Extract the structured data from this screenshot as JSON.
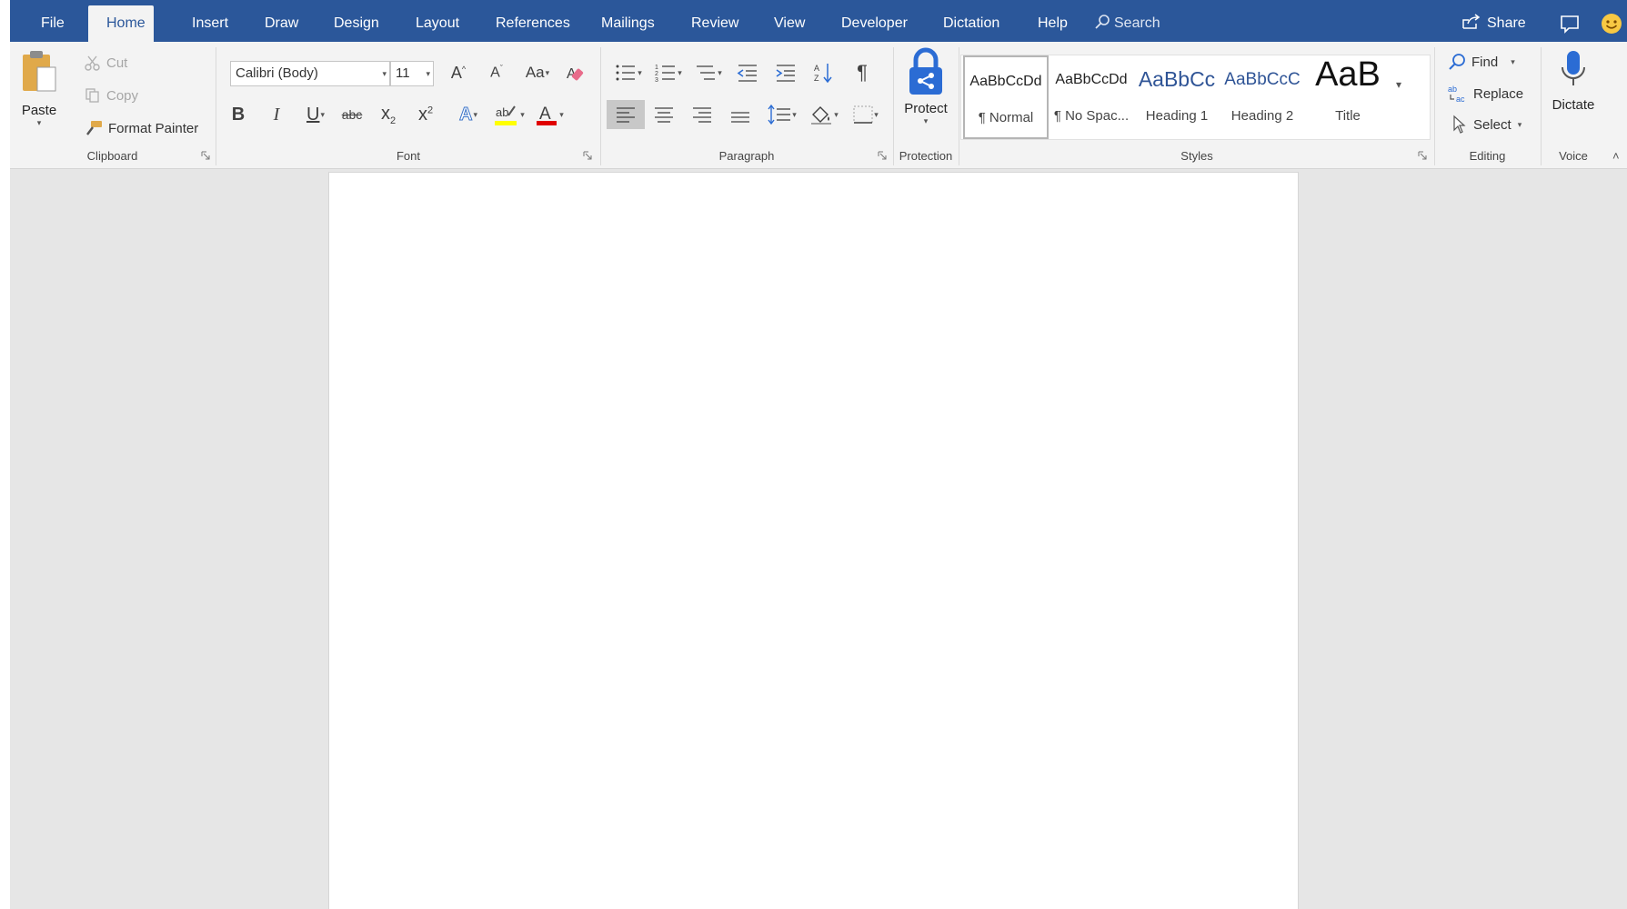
{
  "tabs": [
    {
      "label": "File"
    },
    {
      "label": "Home"
    },
    {
      "label": "Insert"
    },
    {
      "label": "Draw"
    },
    {
      "label": "Design"
    },
    {
      "label": "Layout"
    },
    {
      "label": "References"
    },
    {
      "label": "Mailings"
    },
    {
      "label": "Review"
    },
    {
      "label": "View"
    },
    {
      "label": "Developer"
    },
    {
      "label": "Dictation"
    },
    {
      "label": "Help"
    }
  ],
  "active_tab": "Home",
  "search": {
    "label": "Search"
  },
  "share": {
    "label": "Share"
  },
  "clipboard": {
    "paste_label": "Paste",
    "cut_label": "Cut",
    "copy_label": "Copy",
    "format_painter_label": "Format Painter",
    "group_label": "Clipboard"
  },
  "font": {
    "font_name": "Calibri (Body)",
    "font_size": "11",
    "group_label": "Font",
    "change_case_label": "Aa",
    "strikethrough_label": "abc"
  },
  "paragraph": {
    "group_label": "Paragraph"
  },
  "protection": {
    "protect_label": "Protect",
    "group_label": "Protection"
  },
  "styles": {
    "group_label": "Styles",
    "items": [
      {
        "preview": "AaBbCcDd",
        "name": "¶ Normal"
      },
      {
        "preview": "AaBbCcDd",
        "name": "¶ No Spac..."
      },
      {
        "preview": "AaBbCc",
        "name": "Heading 1"
      },
      {
        "preview": "AaBbCcC",
        "name": "Heading 2"
      },
      {
        "preview": "AaB",
        "name": "Title"
      }
    ]
  },
  "editing": {
    "find_label": "Find",
    "replace_label": "Replace",
    "select_label": "Select",
    "group_label": "Editing"
  },
  "voice": {
    "dictate_label": "Dictate",
    "group_label": "Voice"
  },
  "colors": {
    "brand": "#2b579a",
    "highlight": "#ffff00",
    "font_color": "#e00000",
    "protect": "#2b6cd4"
  }
}
